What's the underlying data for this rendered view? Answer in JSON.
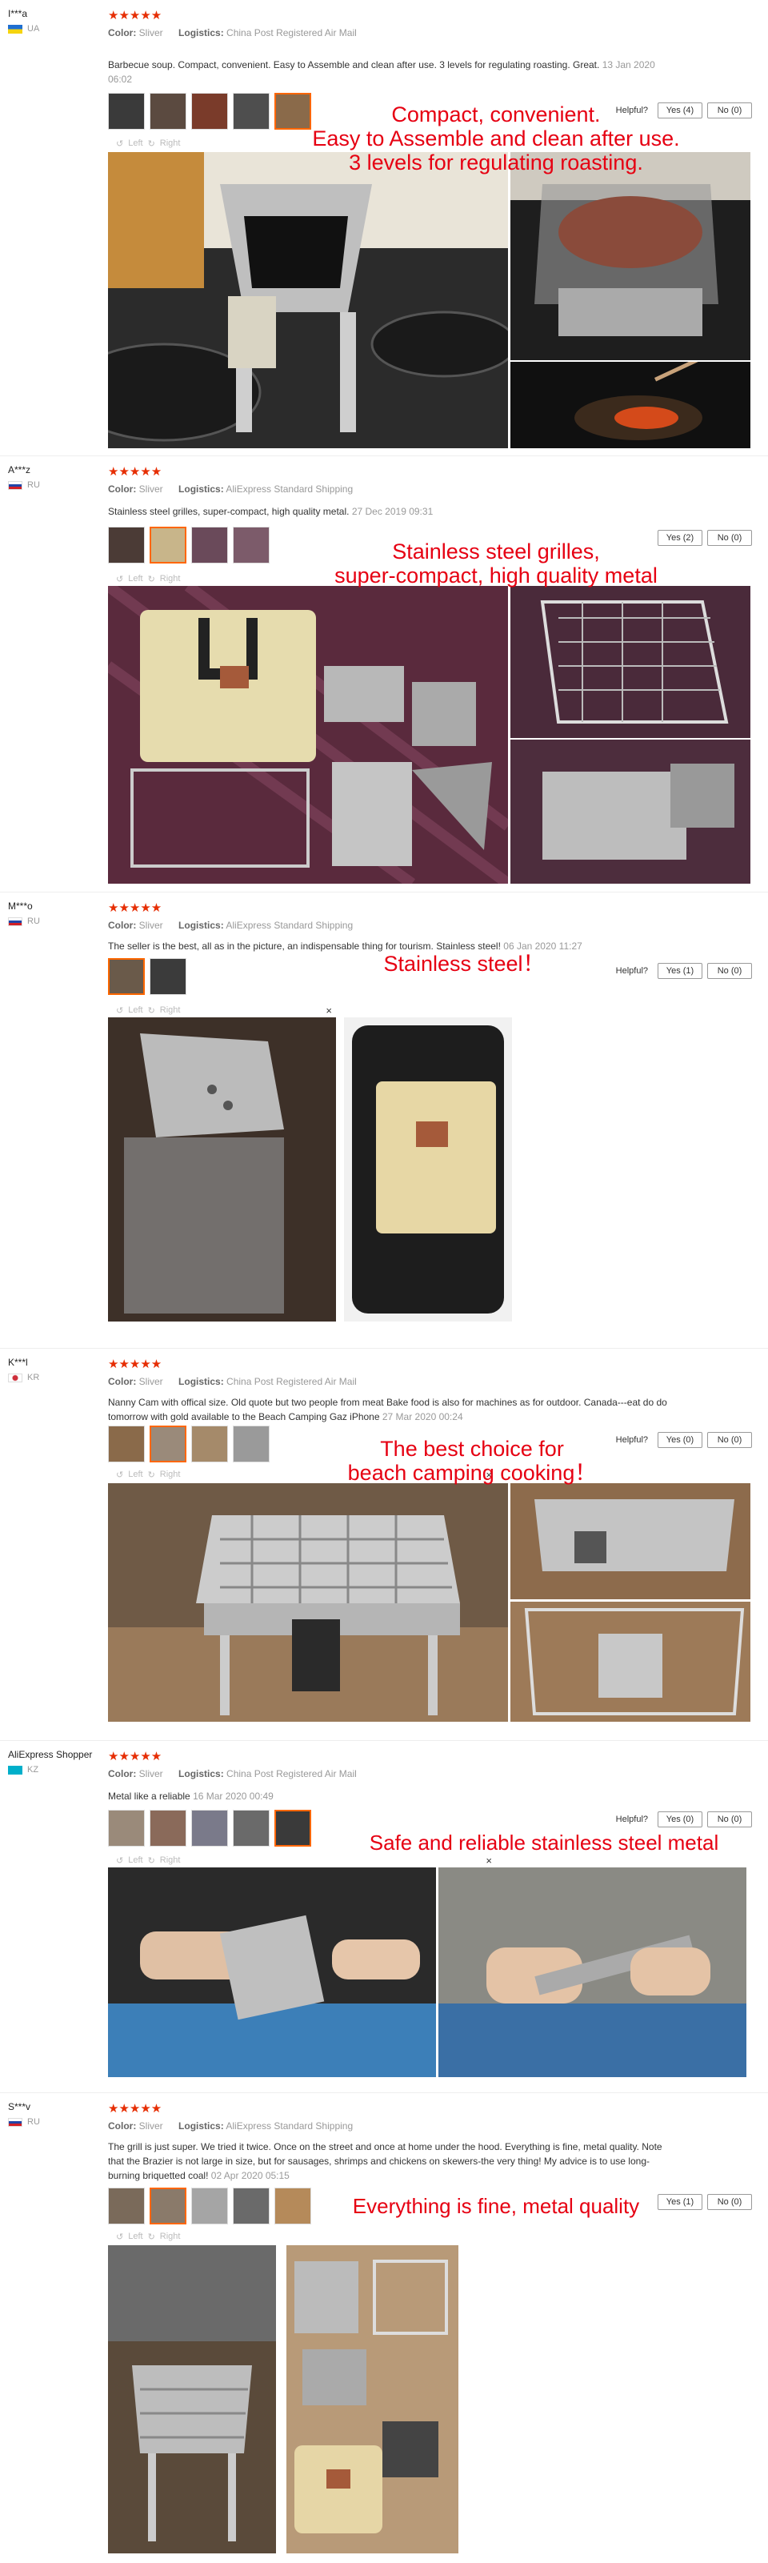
{
  "common": {
    "color_label": "Color:",
    "logistics_label": "Logistics:",
    "helpful_label": "Helpful?",
    "rotate_left": "Left",
    "rotate_right": "Right",
    "close": "×",
    "stars": "★★★★★"
  },
  "reviews": [
    {
      "user": "I***a",
      "country": "UA",
      "color": "Sliver",
      "logistics": "China Post Registered Air Mail",
      "text": "Barbecue soup. Compact, convenient. Easy to Assemble and clean after use. 3 levels for regulating roasting. Great.",
      "date": "13 Jan 2020 06:02",
      "yes": "Yes (4)",
      "no": "No (0)",
      "caption": "Compact, convenient.\nEasy to Assemble and clean after use.\n3 levels for regulating roasting."
    },
    {
      "user": "A***z",
      "country": "RU",
      "color": "Sliver",
      "logistics": "AliExpress Standard Shipping",
      "text": "Stainless steel grilles, super-compact, high quality metal.",
      "date": "27 Dec 2019 09:31",
      "yes": "Yes (2)",
      "no": "No (0)",
      "caption": "Stainless steel grilles,\nsuper-compact, high quality metal"
    },
    {
      "user": "M***o",
      "country": "RU",
      "color": "Sliver",
      "logistics": "AliExpress Standard Shipping",
      "text": "The seller is the best, all as in the picture, an indispensable thing for tourism. Stainless steel!",
      "date": "06 Jan 2020 11:27",
      "yes": "Yes (1)",
      "no": "No (0)",
      "caption": "Stainless steel！"
    },
    {
      "user": "K***l",
      "country": "KR",
      "color": "Sliver",
      "logistics": "China Post Registered Air Mail",
      "text": "Nanny Cam with offical size. Old quote but two people from meat Bake food is also for machines as for outdoor. Canada---eat do do tomorrow with gold available to the Beach Camping Gaz iPhone",
      "date": "27 Mar 2020 00:24",
      "yes": "Yes (0)",
      "no": "No (0)",
      "caption": "The best choice for\nbeach camping cooking！"
    },
    {
      "user": "AliExpress Shopper",
      "country": "KZ",
      "color": "Sliver",
      "logistics": "China Post Registered Air Mail",
      "text": "Metal like a reliable",
      "date": "16 Mar 2020 00:49",
      "yes": "Yes (0)",
      "no": "No (0)",
      "caption": "Safe and reliable stainless steel metal"
    },
    {
      "user": "S***v",
      "country": "RU",
      "color": "Sliver",
      "logistics": "AliExpress Standard Shipping",
      "text": "The grill is just super. We tried it twice. Once on the street and once at home under the hood. Everything is fine, metal quality. Note that the Brazier is not large in size, but for sausages, shrimps and chickens on skewers-the very thing! My advice is to use long-burning briquetted coal!",
      "date": "02 Apr 2020 05:15",
      "yes": "Yes (1)",
      "no": "No (0)",
      "caption": "Everything is fine, metal quality"
    }
  ],
  "colors": {
    "star": "#e62e04",
    "caption": "#e60012",
    "selected_thumb": "#ff6600"
  }
}
